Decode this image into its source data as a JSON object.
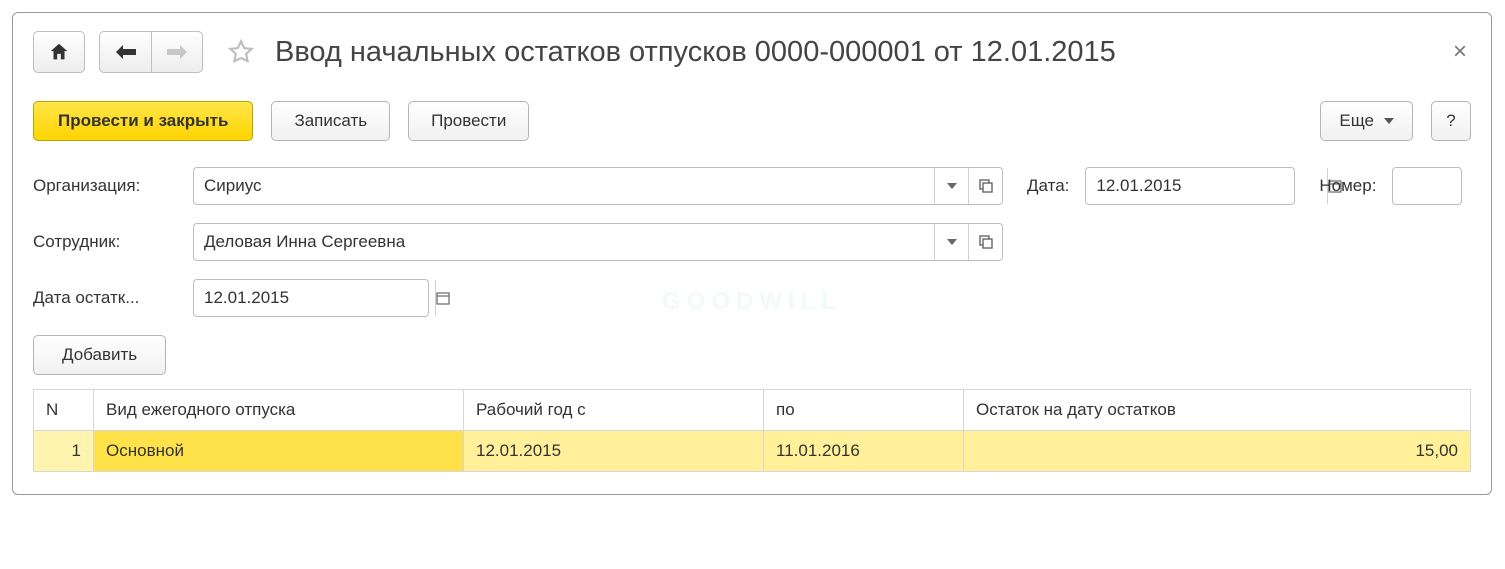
{
  "title": "Ввод начальных остатков отпусков 0000-000001 от 12.01.2015",
  "toolbar": {
    "post_close": "Провести и закрыть",
    "save": "Записать",
    "post": "Провести",
    "more": "Еще",
    "help": "?"
  },
  "form": {
    "org_label": "Организация:",
    "org_value": "Сириус",
    "date_label": "Дата:",
    "date_value": "12.01.2015",
    "number_label": "Номер:",
    "employee_label": "Сотрудник:",
    "employee_value": "Деловая Инна Сергеевна",
    "balance_date_label": "Дата остатк...",
    "balance_date_value": "12.01.2015"
  },
  "add_button": "Добавить",
  "table": {
    "headers": {
      "n": "N",
      "type": "Вид ежегодного отпуска",
      "year_from": "Рабочий год с",
      "year_to": "по",
      "balance": "Остаток на дату остатков"
    },
    "rows": [
      {
        "n": "1",
        "type": "Основной",
        "year_from": "12.01.2015",
        "year_to": "11.01.2016",
        "balance": "15,00"
      }
    ]
  },
  "watermark": "GOODWILL"
}
